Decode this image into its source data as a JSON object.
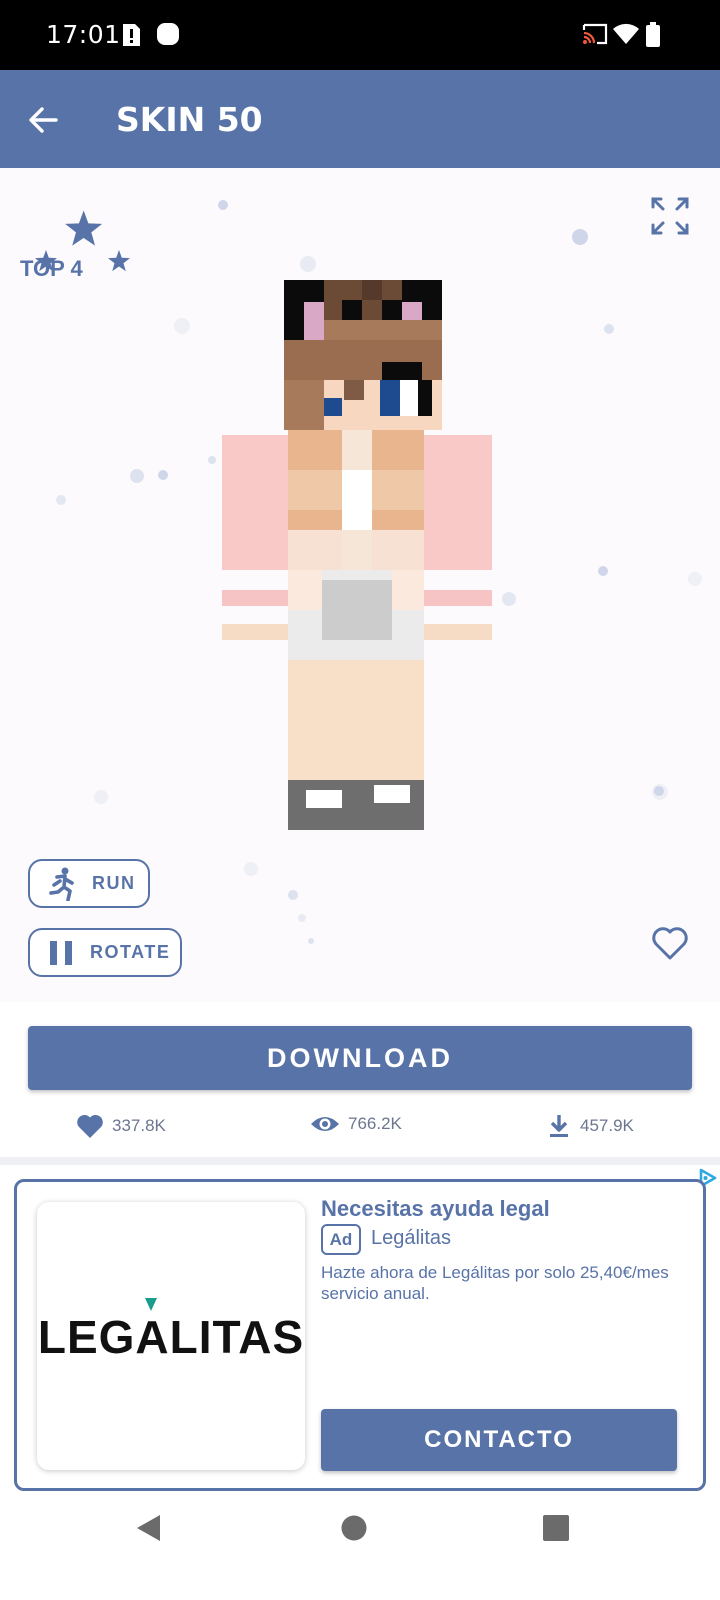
{
  "status_bar": {
    "time": "17:01",
    "left_icons": [
      "alert-notification-icon",
      "app-notification-icon"
    ],
    "right_icons": [
      "cast-icon",
      "wifi-icon",
      "battery-icon"
    ]
  },
  "app_bar": {
    "back_icon": "arrow-left-icon",
    "title": "SKIN 50"
  },
  "viewer": {
    "rank_label": "TOP 4",
    "rank_icon": "three-stars-icon",
    "fullscreen_icon": "expand-icon",
    "run_label": "RUN",
    "run_icon": "running-person-icon",
    "rotate_label": "ROTATE",
    "rotate_icon": "pause-icon",
    "favorite_icon": "heart-outline-icon"
  },
  "download_label": "DOWNLOAD",
  "stats": {
    "likes": "337.8K",
    "views": "766.2K",
    "downloads": "457.9K"
  },
  "ad": {
    "logo_text": "LEGALITAS",
    "title": "Necesitas ayuda legal",
    "badge": "Ad",
    "advertiser": "Legálitas",
    "description": "Hazte ahora de Legálitas por solo 25,40€/mes servicio anual.",
    "cta": "CONTACTO"
  },
  "nav_bar": [
    "back-triangle-icon",
    "home-circle-icon",
    "recents-square-icon"
  ],
  "colors": {
    "primary": "#5873a8",
    "viewer_bg": "#fcfafc",
    "stat_text": "#6d7690"
  }
}
